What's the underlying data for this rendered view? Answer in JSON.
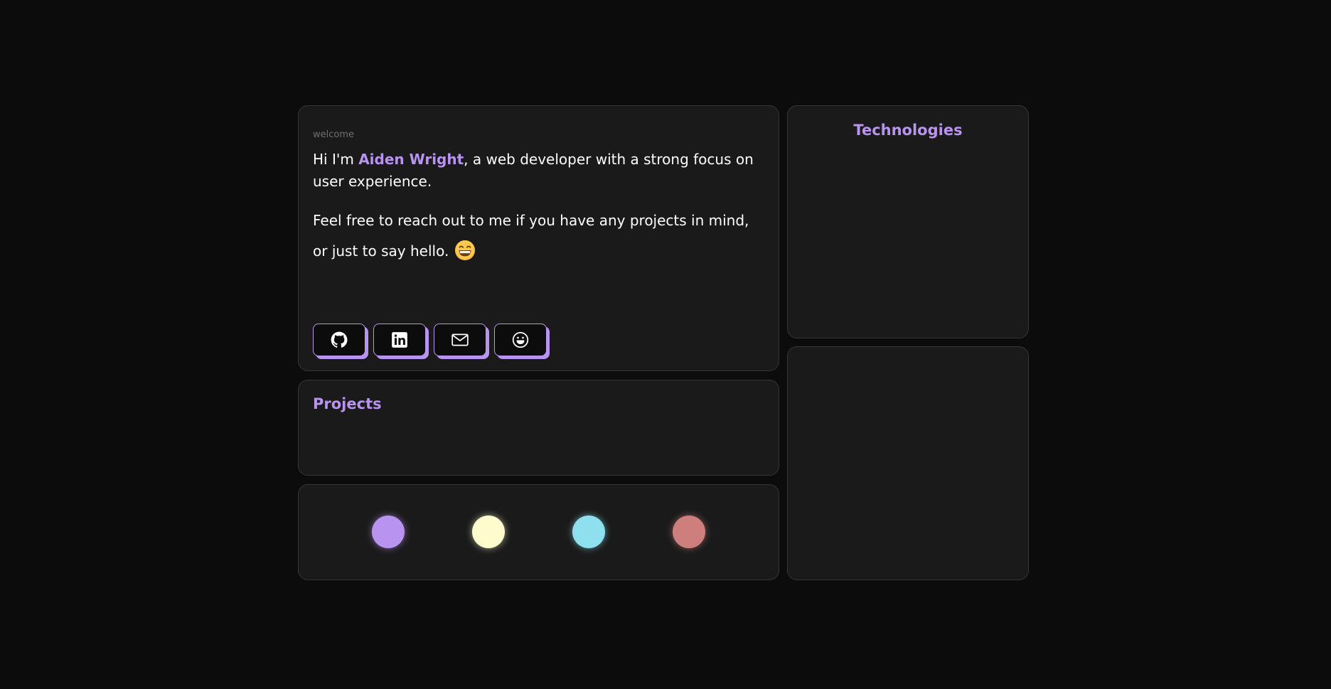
{
  "welcome": {
    "eyebrow": "welcome",
    "intro_prefix": "Hi I'm ",
    "name": "Aiden Wright",
    "intro_suffix": ", a web developer with a strong focus on user experience.",
    "reach_text": "Feel free to reach out to me if you have any projects in mind, or just to say hello.",
    "emoji_icon": "grinning-face-icon",
    "socials": [
      {
        "icon": "github-icon"
      },
      {
        "icon": "linkedin-icon"
      },
      {
        "icon": "mail-icon"
      },
      {
        "icon": "smiley-icon"
      }
    ]
  },
  "projects": {
    "title": "Projects"
  },
  "technologies": {
    "title": "Technologies"
  },
  "theme_colors": [
    {
      "color": "#b993f0"
    },
    {
      "color": "#fefccf"
    },
    {
      "color": "#8ee0ef"
    },
    {
      "color": "#cf7e7e"
    }
  ]
}
